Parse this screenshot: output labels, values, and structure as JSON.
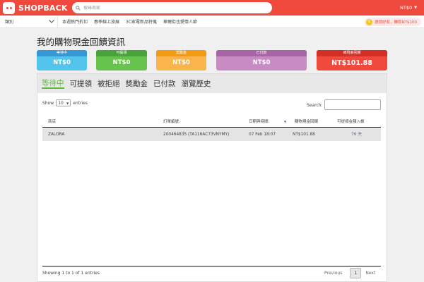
{
  "header": {
    "logo_text": "SHOPBACK",
    "search_placeholder": "搜尋商家",
    "balance": "NT$0",
    "brand_color": "#f04a3e"
  },
  "subnav": {
    "category_label": "類別",
    "links": [
      "本週熱門折扣",
      "春季線上旅展",
      "3C家電新品特蒐",
      "華爾街也愛情人節"
    ],
    "promo_text": "邀請好友，賺取NT$100"
  },
  "page_title": "我的購物現金回饋資訊",
  "summary": [
    {
      "label": "等待中",
      "amount": "NT$0",
      "color": "#53c4eb"
    },
    {
      "label": "可提領",
      "amount": "NT$0",
      "color": "#66c44c"
    },
    {
      "label": "獎勵金",
      "amount": "NT$0",
      "color": "#f9b54b"
    },
    {
      "label": "已付款",
      "amount": "NT$0",
      "color": "#c88bc4"
    },
    {
      "label": "總現金回饋",
      "amount": "NT$101.88",
      "color": "#f04a3e"
    }
  ],
  "tabs": [
    "等待中",
    "可提領",
    "被拒絕",
    "獎勵金",
    "已付款",
    "瀏覽歷史"
  ],
  "active_tab": "等待中",
  "table": {
    "show_label": "Show",
    "page_size": "10",
    "entries_label": "entries",
    "search_label": "Search:",
    "columns": [
      "商店",
      "訂單編號:",
      "日期與時間:",
      "購物現金回饋",
      "可提領金額入帳"
    ],
    "rows": [
      {
        "store": "ZALORA",
        "order": "200464835 (TA116AC73VNYMY)",
        "date": "07 Feb 18:07",
        "cashback": "NT$101.88",
        "days": "76 天"
      }
    ],
    "info": "Showing 1 to 1 of 1 entries",
    "prev": "Previous",
    "page": "1",
    "next": "Next"
  }
}
